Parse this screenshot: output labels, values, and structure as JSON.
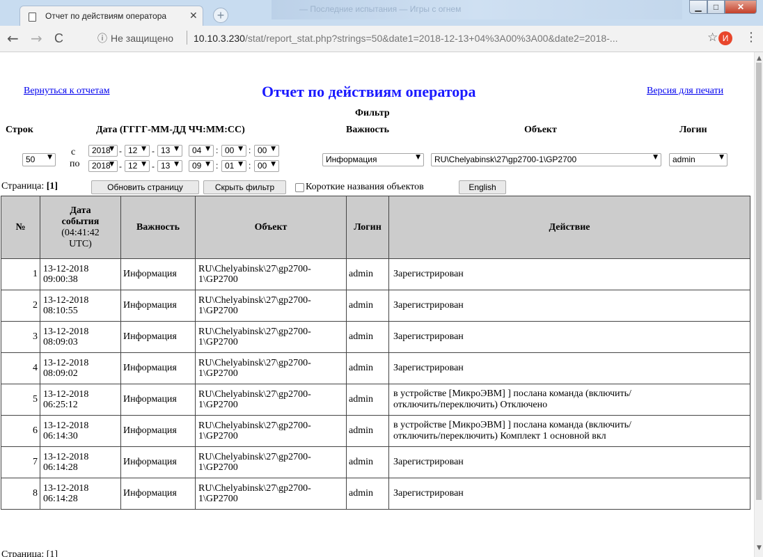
{
  "browser": {
    "tab_title": "Отчет по действиям оператора",
    "tab_close": "✕",
    "new_tab": "+",
    "blurred_title": "— Последние испытания — Игры с огнем",
    "security_label": "Не защищено",
    "url_host": "10.10.3.230",
    "url_path": "/stat/report_stat.php?strings=50&date1=2018-12-13+04%3A00%3A00&date2=2018-...",
    "avatar_letter": "И",
    "min_glyph": "▁",
    "max_glyph": "□",
    "close_glyph": "✕"
  },
  "page": {
    "back_link": "Вернуться к отчетам",
    "title": "Отчет по действиям оператора",
    "print_link": "Версия для печати"
  },
  "filter": {
    "title": "Фильтр",
    "headers": {
      "rows": "Строк",
      "date": "Дата (ГГГГ-ММ-ДД ЧЧ:ММ:СС)",
      "importance": "Важность",
      "object": "Объект",
      "login": "Логин"
    },
    "rows_value": "50",
    "from_label": "с",
    "to_label": "по",
    "from": {
      "year": "2018",
      "month": "12",
      "day": "13",
      "hour": "04",
      "minute": "00",
      "second": "00"
    },
    "to": {
      "year": "2018",
      "month": "12",
      "day": "13",
      "hour": "09",
      "minute": "01",
      "second": "00"
    },
    "importance_value": "Информация",
    "object_value": "RU\\Chelyabinsk\\27\\gp2700-1\\GP2700",
    "login_value": "admin"
  },
  "controls": {
    "page_label": "Страница:",
    "page_current": "[1]",
    "refresh_button": "Обновить страницу",
    "hide_filter_button": "Скрыть фильтр",
    "short_names_label": "Короткие названия объектов",
    "english_button": "English"
  },
  "table": {
    "headers": {
      "num": "№",
      "date_line1": "Дата",
      "date_line2": "события",
      "date_time": "(04:41:42",
      "date_tz": "UTC)",
      "importance": "Важность",
      "object": "Объект",
      "login": "Логин",
      "action": "Действие"
    },
    "rows": [
      {
        "num": "1",
        "date": "13-12-2018",
        "time": "09:00:38",
        "importance": "Информация",
        "obj1": "RU\\Chelyabinsk\\27\\gp2700-",
        "obj2": "1\\GP2700",
        "login": "admin",
        "act1": "Зарегистрирован",
        "act2": ""
      },
      {
        "num": "2",
        "date": "13-12-2018",
        "time": "08:10:55",
        "importance": "Информация",
        "obj1": "RU\\Chelyabinsk\\27\\gp2700-",
        "obj2": "1\\GP2700",
        "login": "admin",
        "act1": "Зарегистрирован",
        "act2": ""
      },
      {
        "num": "3",
        "date": "13-12-2018",
        "time": "08:09:03",
        "importance": "Информация",
        "obj1": "RU\\Chelyabinsk\\27\\gp2700-",
        "obj2": "1\\GP2700",
        "login": "admin",
        "act1": "Зарегистрирован",
        "act2": ""
      },
      {
        "num": "4",
        "date": "13-12-2018",
        "time": "08:09:02",
        "importance": "Информация",
        "obj1": "RU\\Chelyabinsk\\27\\gp2700-",
        "obj2": "1\\GP2700",
        "login": "admin",
        "act1": "Зарегистрирован",
        "act2": ""
      },
      {
        "num": "5",
        "date": "13-12-2018",
        "time": "06:25:12",
        "importance": "Информация",
        "obj1": "RU\\Chelyabinsk\\27\\gp2700-",
        "obj2": "1\\GP2700",
        "login": "admin",
        "act1": "в устройстве [МикроЭВМ] ] послана команда (включить/",
        "act2": "отключить/переключить) Отключено"
      },
      {
        "num": "6",
        "date": "13-12-2018",
        "time": "06:14:30",
        "importance": "Информация",
        "obj1": "RU\\Chelyabinsk\\27\\gp2700-",
        "obj2": "1\\GP2700",
        "login": "admin",
        "act1": "в устройстве [МикроЭВМ] ] послана команда (включить/",
        "act2": "отключить/переключить) Комплект 1 основной вкл"
      },
      {
        "num": "7",
        "date": "13-12-2018",
        "time": "06:14:28",
        "importance": "Информация",
        "obj1": "RU\\Chelyabinsk\\27\\gp2700-",
        "obj2": "1\\GP2700",
        "login": "admin",
        "act1": "Зарегистрирован",
        "act2": ""
      },
      {
        "num": "8",
        "date": "13-12-2018",
        "time": "06:14:28",
        "importance": "Информация",
        "obj1": "RU\\Chelyabinsk\\27\\gp2700-",
        "obj2": "1\\GP2700",
        "login": "admin",
        "act1": "Зарегистрирован",
        "act2": ""
      }
    ]
  },
  "footer": {
    "page_label": "Страница: [1]"
  },
  "icons": {
    "back": "←",
    "forward": "→",
    "reload": "C",
    "info": "ⓘ",
    "star": "☆",
    "menu": "⋮",
    "dropdown": "▼"
  }
}
